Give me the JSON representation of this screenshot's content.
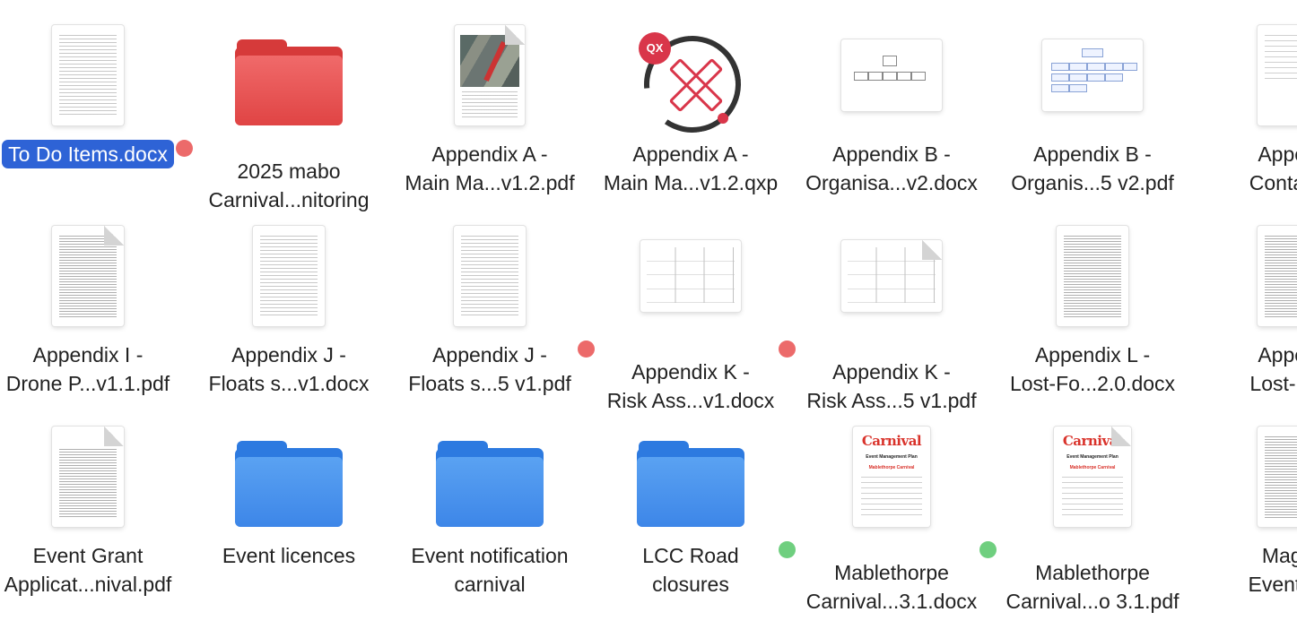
{
  "colors": {
    "selection": "#2e63d6",
    "tag_red": "#ec6a6a",
    "tag_green": "#6fcf7f",
    "folder_red": "#e04444",
    "folder_blue": "#3d86e8"
  },
  "files": [
    {
      "line1": "To Do Items.docx",
      "line2": "",
      "thumb": "doc-lines",
      "tag": null,
      "selected": true
    },
    {
      "line1": "2025 mabo",
      "line2": "Carnival...nitoring",
      "thumb": "folder-red",
      "tag": "red",
      "selected": false
    },
    {
      "line1": "Appendix A -",
      "line2": "Main Ma...v1.2.pdf",
      "thumb": "doc-map",
      "tag": null,
      "selected": false
    },
    {
      "line1": "Appendix A -",
      "line2": "Main Ma...v1.2.qxp",
      "thumb": "quarkxpress-app",
      "tag": null,
      "selected": false
    },
    {
      "line1": "Appendix B -",
      "line2": "Organisa...v2.docx",
      "thumb": "doc-org-landscape",
      "tag": null,
      "selected": false
    },
    {
      "line1": "Appendix B -",
      "line2": "Organis...5 v2.pdf",
      "thumb": "doc-org-blue",
      "tag": null,
      "selected": false
    },
    {
      "line1": "Append",
      "line2": "Contact...",
      "thumb": "doc-sparse",
      "tag": null,
      "selected": false
    },
    {
      "line1": "Appendix I -",
      "line2": "Drone P...v1.1.pdf",
      "thumb": "doc-dense-fold",
      "tag": null,
      "selected": false
    },
    {
      "line1": "Appendix J -",
      "line2": "Floats s...v1.docx",
      "thumb": "doc-lines",
      "tag": null,
      "selected": false
    },
    {
      "line1": "Appendix J -",
      "line2": "Floats s...5 v1.pdf",
      "thumb": "doc-lines",
      "tag": null,
      "selected": false
    },
    {
      "line1": "Appendix K -",
      "line2": "Risk Ass...v1.docx",
      "thumb": "doc-table",
      "tag": "red",
      "selected": false
    },
    {
      "line1": "Appendix K -",
      "line2": "Risk Ass...5 v1.pdf",
      "thumb": "doc-table-fold",
      "tag": "red",
      "selected": false
    },
    {
      "line1": "Appendix L -",
      "line2": "Lost-Fo...2.0.docx",
      "thumb": "doc-dense",
      "tag": null,
      "selected": false
    },
    {
      "line1": "Append",
      "line2": "Lost-Fo...",
      "thumb": "doc-dense",
      "tag": null,
      "selected": false
    },
    {
      "line1": "Event Grant",
      "line2": "Applicat...nival.pdf",
      "thumb": "doc-form-fold",
      "tag": null,
      "selected": false
    },
    {
      "line1": "Event licences",
      "line2": "",
      "thumb": "folder-blue",
      "tag": null,
      "selected": false
    },
    {
      "line1": "Event notification",
      "line2": "carnival",
      "thumb": "folder-blue",
      "tag": null,
      "selected": false
    },
    {
      "line1": "LCC Road",
      "line2": "closures",
      "thumb": "folder-blue",
      "tag": null,
      "selected": false
    },
    {
      "line1": "Mablethorpe",
      "line2": "Carnival...3.1.docx",
      "thumb": "doc-carnival",
      "tag": "green",
      "selected": false
    },
    {
      "line1": "Mablethorpe",
      "line2": "Carnival...o 3.1.pdf",
      "thumb": "doc-carnival-fold",
      "tag": "green",
      "selected": false
    },
    {
      "line1": "Magna",
      "line2": "Event N...",
      "thumb": "doc-dense",
      "tag": null,
      "selected": false
    }
  ],
  "thumb_text": {
    "carnival": "Carnival",
    "event_management_plan": "Event Management Plan",
    "mablethorpe_carnival": "Mablethorpe Carnival",
    "qx_badge": "QX"
  }
}
